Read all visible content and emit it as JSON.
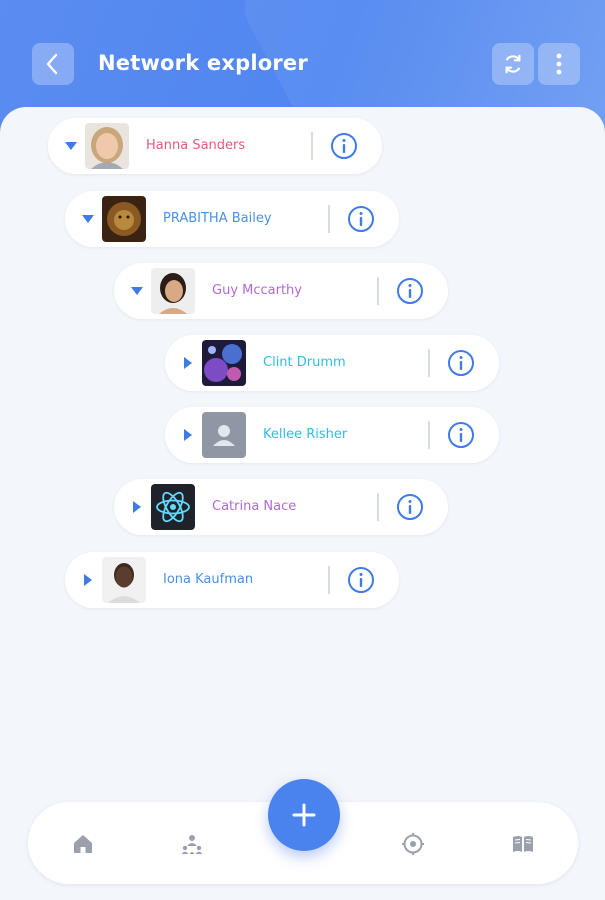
{
  "header": {
    "title": "Network explorer",
    "back_icon": "chevron-left-icon",
    "refresh_icon": "refresh-icon",
    "more_icon": "more-vertical-icon",
    "bg_color": "#5b8cf0"
  },
  "tree": {
    "nodes": [
      {
        "name": "Hanna Sanders",
        "color": "#e8577e",
        "expanded": true,
        "avatar": "photo-woman-blonde"
      },
      {
        "name": "PRABITHA Bailey",
        "color": "#4a90e2",
        "expanded": true,
        "avatar": "photo-lion"
      },
      {
        "name": "Guy Mccarthy",
        "color": "#b06ad6",
        "expanded": true,
        "avatar": "photo-woman-dark-hair"
      },
      {
        "name": "Clint Drumm",
        "color": "#2fbde0",
        "expanded": false,
        "avatar": "photo-abstract-purple"
      },
      {
        "name": "Kellee Risher",
        "color": "#2fbde0",
        "expanded": false,
        "avatar": "default-user-placeholder"
      },
      {
        "name": "Catrina Nace",
        "color": "#b06ad6",
        "expanded": false,
        "avatar": "react-logo"
      },
      {
        "name": "Iona Kaufman",
        "color": "#4a90e2",
        "expanded": false,
        "avatar": "photo-man"
      }
    ],
    "info_icon": "info-circle-icon"
  },
  "bottom_nav": {
    "items": [
      "home-icon",
      "people-network-icon",
      "add-icon",
      "target-icon",
      "book-icon"
    ]
  },
  "colors": {
    "accent": "#4a83ee",
    "background": "#f3f6fa"
  }
}
